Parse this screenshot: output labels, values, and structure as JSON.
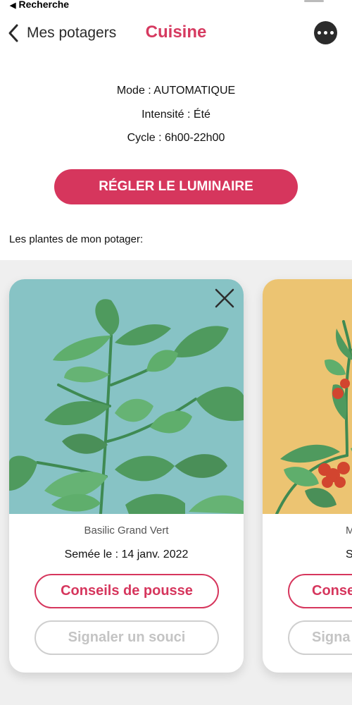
{
  "status_bar": {
    "back_label": "Recherche",
    "back_glyph": "◀"
  },
  "nav": {
    "back_label": "Mes potagers",
    "title": "Cuisine",
    "more_icon": "ellipsis-icon"
  },
  "luminaire": {
    "mode": "Mode : AUTOMATIQUE",
    "intensity": "Intensité : Été",
    "cycle": "Cycle : 6h00-22h00",
    "adjust_label": "RÉGLER LE LUMINAIRE"
  },
  "plants_heading": "Les plantes de mon potager:",
  "plants": [
    {
      "name": "Basilic Grand Vert",
      "sowing_date": "Semée le : 14 janv. 2022",
      "advice_label": "Conseils de pousse",
      "report_label": "Signaler un souci",
      "image_bg": "#87c3c5"
    },
    {
      "name": "M",
      "sowing_date": "Semée",
      "advice_label": "Conse",
      "report_label": "Signa",
      "image_bg": "#ecc472"
    }
  ],
  "colors": {
    "accent": "#d6365d",
    "title": "#d63a60",
    "disabled": "#c4c4c4",
    "carousel_bg": "#efefef"
  }
}
